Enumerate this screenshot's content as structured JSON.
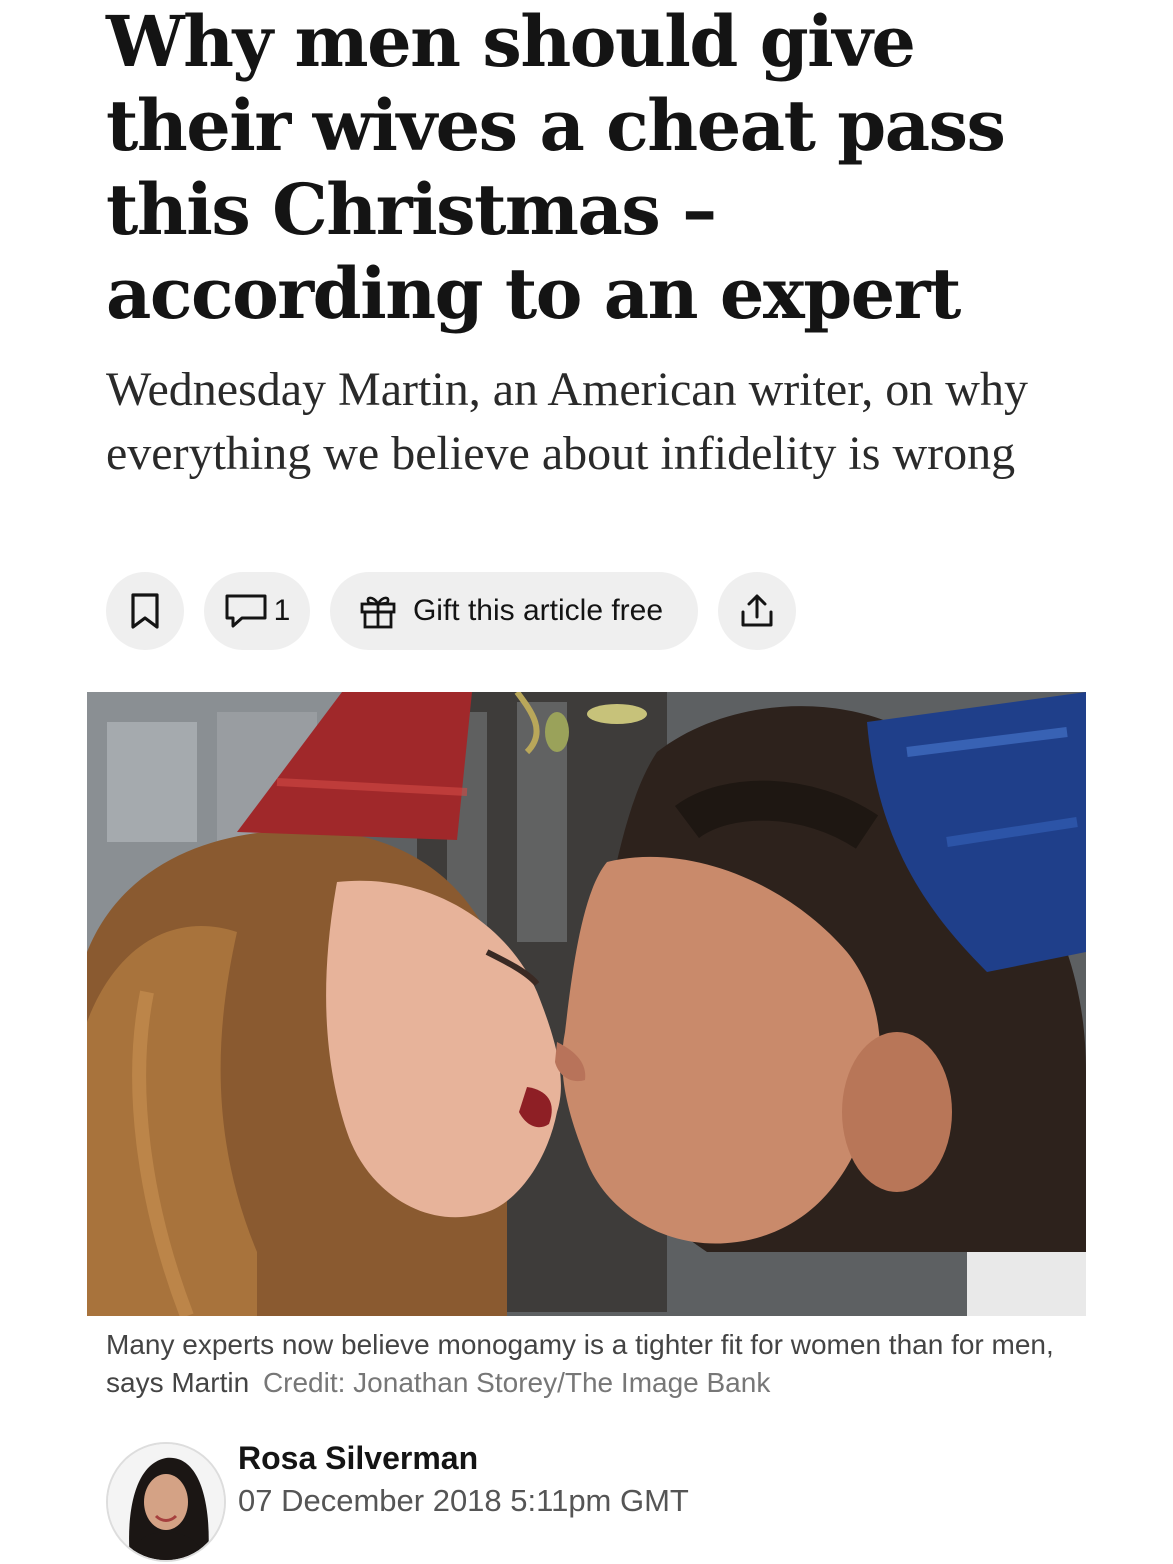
{
  "article": {
    "headline": "Why men should give their wives a cheat pass this Christmas – according to an expert",
    "standfirst": "Wednesday Martin, an American writer, on why everything we believe about infidelity is wrong"
  },
  "actions": {
    "bookmark_icon": "bookmark-icon",
    "comment_icon": "comment-icon",
    "comment_count": "1",
    "gift_icon": "gift-icon",
    "gift_label": "Gift this article free",
    "share_icon": "share-icon"
  },
  "image": {
    "caption": "Many experts now believe monogamy is a tighter fit for women than for men, says Martin",
    "credit": "Credit: Jonathan Storey/The Image Bank"
  },
  "author": {
    "name": "Rosa Silverman",
    "date": "07 December 2018 5:11pm GMT"
  },
  "colors": {
    "text": "#141414",
    "pill_background": "#efefef",
    "caption": "#444444",
    "credit": "#777777"
  }
}
